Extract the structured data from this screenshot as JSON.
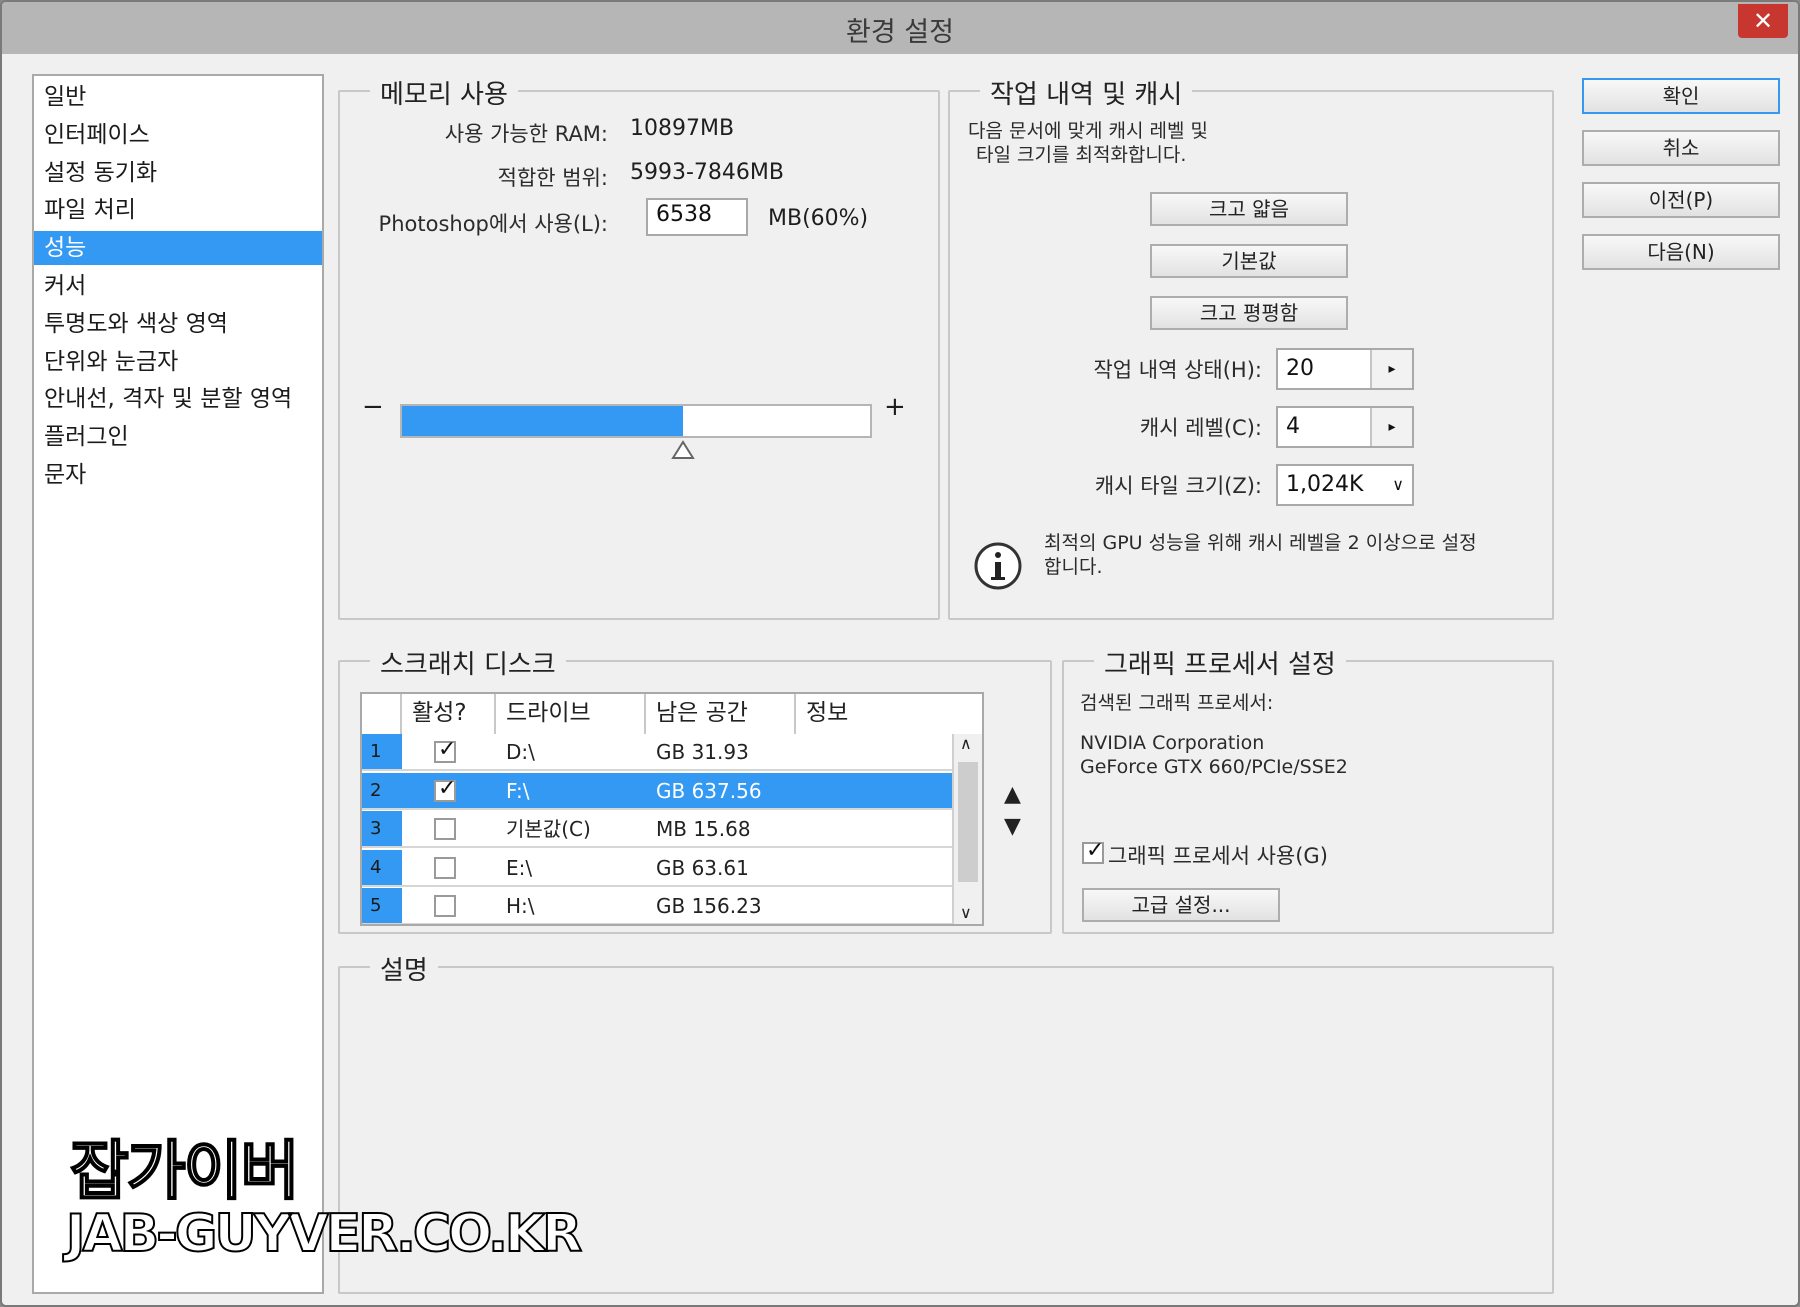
{
  "window": {
    "title": "환경 설정",
    "close_label": "✕"
  },
  "nav": {
    "items": [
      "일반",
      "인터페이스",
      "설정 동기화",
      "파일 처리",
      "성능",
      "커서",
      "투명도와 색상 영역",
      "단위와 눈금자",
      "안내선, 격자 및 분할 영역",
      "플러그인",
      "문자"
    ],
    "selected_index": 4
  },
  "memory": {
    "title": "메모리 사용",
    "available_label": "사용 가능한 RAM:",
    "available_value": "10897MB",
    "range_label": "적합한 범위:",
    "range_value": "5993-7846MB",
    "use_label": "Photoshop에서 사용(L):",
    "use_value": "6538",
    "use_suffix": "MB(60%)",
    "slider_fraction": 0.6,
    "minus": "−",
    "plus": "+"
  },
  "history": {
    "title": "작업 내역 및 캐시",
    "desc_line1": "다음 문서에 맞게 캐시 레벨 및",
    "desc_line2": "타일 크기를 최적화합니다.",
    "btn_large_narrow": "크고 얇음",
    "btn_default": "기본값",
    "btn_large_flat": "크고 평평함",
    "states_label": "작업 내역 상태(H):",
    "states_value": "20",
    "cache_levels_label": "캐시 레벨(C):",
    "cache_levels_value": "4",
    "tile_size_label": "캐시 타일 크기(Z):",
    "tile_size_value": "1,024K",
    "info_line1": "최적의 GPU 성능을 위해 캐시 레벨을 2 이상으로 설정",
    "info_line2": "합니다."
  },
  "scratch": {
    "title": "스크래치 디스크",
    "headers": [
      "활성?",
      "드라이브",
      "남은 공간",
      "정보"
    ],
    "rows": [
      {
        "num": "1",
        "checked": true,
        "drive": "D:\\",
        "free": "GB 31.93"
      },
      {
        "num": "2",
        "checked": true,
        "drive": "F:\\",
        "free": "GB 637.56"
      },
      {
        "num": "3",
        "checked": false,
        "drive": "기본값(C)",
        "free": "MB 15.68"
      },
      {
        "num": "4",
        "checked": false,
        "drive": "E:\\",
        "free": "GB 63.61"
      },
      {
        "num": "5",
        "checked": false,
        "drive": "H:\\",
        "free": "GB 156.23"
      }
    ],
    "selected_index": 1
  },
  "gpu": {
    "title": "그래픽 프로세서 설정",
    "detected_label": "검색된 그래픽 프로세서:",
    "vendor": "NVIDIA Corporation",
    "model": "GeForce GTX 660/PCIe/SSE2",
    "use_label": "그래픽 프로세서 사용(G)",
    "use_checked": true,
    "advanced_btn": "고급 설정..."
  },
  "description": {
    "title": "설명"
  },
  "buttons": {
    "ok": "확인",
    "cancel": "취소",
    "prev": "이전(P)",
    "next": "다음(N)"
  },
  "watermark": {
    "line1": "잡가이버",
    "line2": "JAB-GUYVER.CO.KR"
  }
}
